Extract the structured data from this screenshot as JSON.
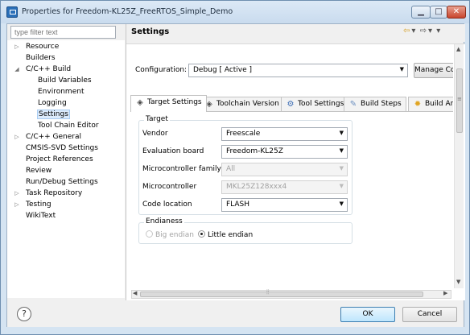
{
  "window": {
    "title": "Properties for Freedom-KL25Z_FreeRTOS_Simple_Demo",
    "min_glyph": "▁",
    "max_glyph": "□",
    "close_glyph": "✕"
  },
  "filter": {
    "placeholder": "type filter text"
  },
  "tree": {
    "items": [
      {
        "label": "Resource",
        "indent": 0,
        "arrow": "▷",
        "selected": false
      },
      {
        "label": "Builders",
        "indent": 0,
        "arrow": "",
        "selected": false
      },
      {
        "label": "C/C++ Build",
        "indent": 0,
        "arrow": "◢",
        "selected": false
      },
      {
        "label": "Build Variables",
        "indent": 1,
        "arrow": "",
        "selected": false
      },
      {
        "label": "Environment",
        "indent": 1,
        "arrow": "",
        "selected": false
      },
      {
        "label": "Logging",
        "indent": 1,
        "arrow": "",
        "selected": false
      },
      {
        "label": "Settings",
        "indent": 1,
        "arrow": "",
        "selected": true
      },
      {
        "label": "Tool Chain Editor",
        "indent": 1,
        "arrow": "",
        "selected": false
      },
      {
        "label": "C/C++ General",
        "indent": 0,
        "arrow": "▷",
        "selected": false
      },
      {
        "label": "CMSIS-SVD Settings",
        "indent": 0,
        "arrow": "",
        "selected": false
      },
      {
        "label": "Project References",
        "indent": 0,
        "arrow": "",
        "selected": false
      },
      {
        "label": "Review",
        "indent": 0,
        "arrow": "",
        "selected": false
      },
      {
        "label": "Run/Debug Settings",
        "indent": 0,
        "arrow": "",
        "selected": false
      },
      {
        "label": "Task Repository",
        "indent": 0,
        "arrow": "▷",
        "selected": false
      },
      {
        "label": "Testing",
        "indent": 0,
        "arrow": "▷",
        "selected": false
      },
      {
        "label": "WikiText",
        "indent": 0,
        "arrow": "",
        "selected": false
      }
    ]
  },
  "page": {
    "title": "Settings",
    "nav": {
      "back": "⇦",
      "dropdown": "▾",
      "forward": "⇨",
      "menu": "▾"
    }
  },
  "configuration": {
    "label": "Configuration:",
    "value": "Debug  [ Active ]",
    "manage_button": "Manage Configurations..."
  },
  "tabs": [
    {
      "label": "Target Settings",
      "icon": "gear-icon",
      "glyph": "◈",
      "color": "#4a4a4a",
      "active": true
    },
    {
      "label": "Toolchain Version",
      "icon": "gear-icon",
      "glyph": "◈",
      "color": "#4a4a4a",
      "active": false
    },
    {
      "label": "Tool Settings",
      "icon": "tool-settings-icon",
      "glyph": "⚙",
      "color": "#3f6fb5",
      "active": false
    },
    {
      "label": "Build Steps",
      "icon": "build-steps-icon",
      "glyph": "✎",
      "color": "#6b8fc0",
      "active": false
    },
    {
      "label": "Build Artifact",
      "icon": "build-artifact-icon",
      "glyph": "✹",
      "color": "#e0a421",
      "active": false
    }
  ],
  "target": {
    "group_label": "Target",
    "fields": [
      {
        "label": "Vendor",
        "value": "Freescale",
        "enabled": true
      },
      {
        "label": "Evaluation board",
        "value": "Freedom-KL25Z",
        "enabled": true
      },
      {
        "label": "Microcontroller family",
        "value": "All",
        "enabled": false
      },
      {
        "label": "Microcontroller",
        "value": "MKL25Z128xxx4",
        "enabled": false
      },
      {
        "label": "Code location",
        "value": "FLASH",
        "enabled": true
      }
    ]
  },
  "endianess": {
    "group_label": "Endianess",
    "options": [
      {
        "label": "Big endian",
        "selected": false,
        "enabled": false
      },
      {
        "label": "Little endian",
        "selected": true,
        "enabled": true
      }
    ]
  },
  "buttons": {
    "ok": "OK",
    "cancel": "Cancel",
    "help": "?"
  }
}
